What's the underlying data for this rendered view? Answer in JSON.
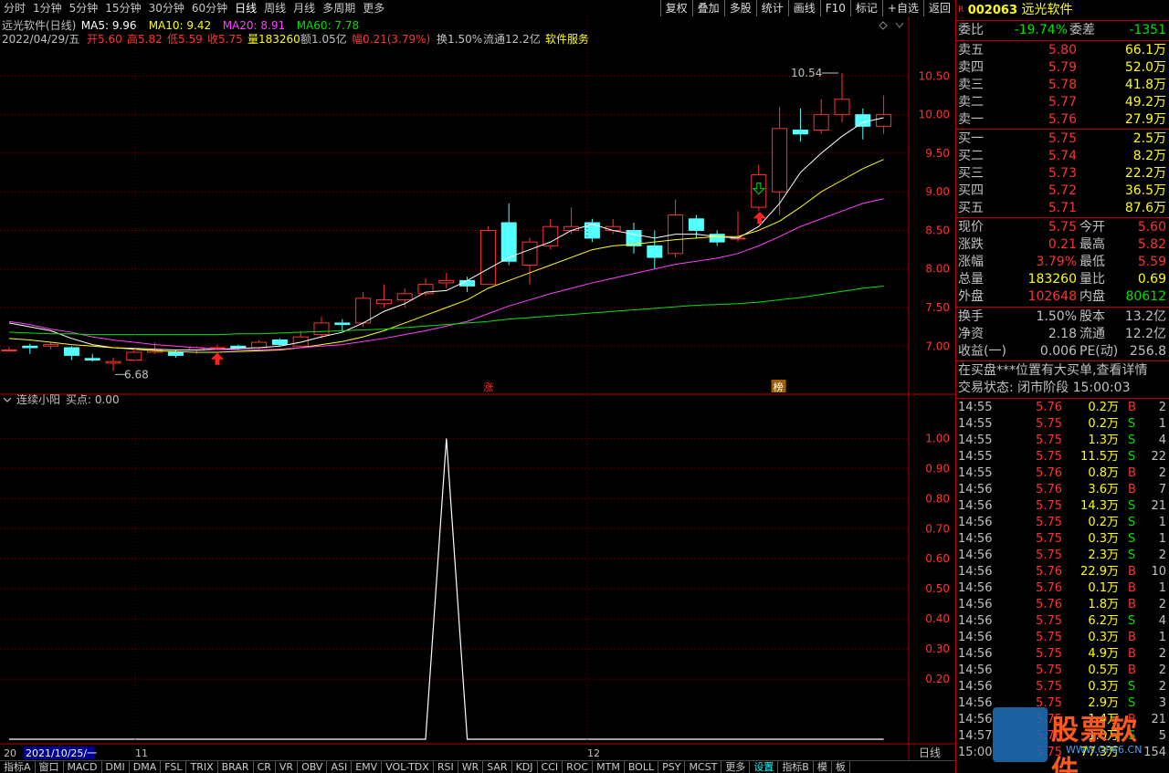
{
  "menu": {
    "items": [
      "分时",
      "1分钟",
      "5分钟",
      "15分钟",
      "30分钟",
      "60分钟",
      "日线",
      "周线",
      "月线",
      "多周期",
      "更多"
    ],
    "active": "日线",
    "right": [
      "复权",
      "叠加",
      "多股",
      "统计",
      "画线",
      "F10",
      "标记",
      "+自选",
      "返回"
    ]
  },
  "header": {
    "title": "远光软件(日线)",
    "ma5": "MA5: 9.96",
    "ma10": "MA10: 9.42",
    "ma20": "MA20: 8.91",
    "ma60": "MA60: 7.78",
    "info_date": "2022/04/29/五",
    "open": "开5.60",
    "high": "高5.82",
    "low": "低5.59",
    "close": "收5.75",
    "volume": "量183260",
    "amount": "额1.05亿",
    "change": "幅0.21(3.79%)",
    "turnover": "换1.50%",
    "float": "流通12.2亿",
    "sector": "软件服务"
  },
  "colors": {
    "up": "#ff3232",
    "down": "#54ffff",
    "ma5": "#ffffff",
    "ma10": "#ffff00",
    "ma20": "#ff40ff",
    "ma60": "#00e000"
  },
  "annotations": {
    "max_label": "10.54",
    "min_label": "6.68",
    "zhang": "涨",
    "bang": "榜"
  },
  "chart_data": [
    {
      "type": "candlestick",
      "title": "远光软件(日线)",
      "ylim": [
        6.4,
        10.8
      ],
      "y_ticks": [
        "10.50",
        "10.00",
        "9.50",
        "9.00",
        "8.50",
        "8.00",
        "7.50",
        "7.00"
      ],
      "candles": [
        [
          6.95,
          6.95,
          6.99,
          6.93
        ],
        [
          7.0,
          6.98,
          7.03,
          6.9
        ],
        [
          7.0,
          7.02,
          7.05,
          6.96
        ],
        [
          6.98,
          6.88,
          7.0,
          6.82
        ],
        [
          6.84,
          6.82,
          6.9,
          6.8
        ],
        [
          6.78,
          6.8,
          6.85,
          6.68
        ],
        [
          6.82,
          6.92,
          6.95,
          6.8
        ],
        [
          6.92,
          6.95,
          7.05,
          6.9
        ],
        [
          6.92,
          6.88,
          6.95,
          6.85
        ],
        [
          6.95,
          6.98,
          7.0,
          6.9
        ],
        [
          6.98,
          6.98,
          7.02,
          6.95
        ],
        [
          7.0,
          6.98,
          7.02,
          6.95
        ],
        [
          6.98,
          7.05,
          7.08,
          6.95
        ],
        [
          7.08,
          7.02,
          7.1,
          7.0
        ],
        [
          7.0,
          7.12,
          7.2,
          6.98
        ],
        [
          7.15,
          7.3,
          7.38,
          7.1
        ],
        [
          7.3,
          7.28,
          7.35,
          7.2
        ],
        [
          7.3,
          7.62,
          7.7,
          7.25
        ],
        [
          7.55,
          7.6,
          7.8,
          7.5
        ],
        [
          7.6,
          7.68,
          7.75,
          7.5
        ],
        [
          7.68,
          7.8,
          7.88,
          7.65
        ],
        [
          7.82,
          7.85,
          7.95,
          7.75
        ],
        [
          7.85,
          7.78,
          7.9,
          7.7
        ],
        [
          7.8,
          8.5,
          8.55,
          7.8
        ],
        [
          8.6,
          8.1,
          8.85,
          8.05
        ],
        [
          8.05,
          8.35,
          8.4,
          7.8
        ],
        [
          8.3,
          8.55,
          8.65,
          8.25
        ],
        [
          8.5,
          8.55,
          8.8,
          8.45
        ],
        [
          8.6,
          8.4,
          8.65,
          8.35
        ],
        [
          8.5,
          8.55,
          8.65,
          8.45
        ],
        [
          8.5,
          8.3,
          8.6,
          8.2
        ],
        [
          8.3,
          8.15,
          8.5,
          8.0
        ],
        [
          8.2,
          8.7,
          8.9,
          8.15
        ],
        [
          8.65,
          8.5,
          8.7,
          8.4
        ],
        [
          8.45,
          8.35,
          8.5,
          8.3
        ],
        [
          8.4,
          8.4,
          8.75,
          8.35
        ],
        [
          8.8,
          9.22,
          9.35,
          8.75
        ],
        [
          9.0,
          9.82,
          10.1,
          8.7
        ],
        [
          9.8,
          9.75,
          10.08,
          9.65
        ],
        [
          9.8,
          10.0,
          10.2,
          9.75
        ],
        [
          10.0,
          10.2,
          10.54,
          9.9
        ],
        [
          10.0,
          9.85,
          10.08,
          9.68
        ],
        [
          9.85,
          10.0,
          10.25,
          9.75
        ]
      ],
      "ma5": [
        7.3,
        7.25,
        7.2,
        7.1,
        7.02,
        6.98,
        6.97,
        6.96,
        6.95,
        6.95,
        6.96,
        6.97,
        6.98,
        7.0,
        7.05,
        7.12,
        7.18,
        7.3,
        7.45,
        7.55,
        7.7,
        7.72,
        7.85,
        8.0,
        8.15,
        8.25,
        8.35,
        8.5,
        8.58,
        8.5,
        8.45,
        8.4,
        8.45,
        8.45,
        8.42,
        8.4,
        8.55,
        8.85,
        9.25,
        9.5,
        9.72,
        9.9,
        9.96
      ],
      "ma10": [
        7.1,
        7.08,
        7.05,
        7.02,
        7.0,
        6.98,
        6.96,
        6.94,
        6.93,
        6.92,
        6.92,
        6.93,
        6.94,
        6.95,
        6.98,
        7.02,
        7.06,
        7.12,
        7.2,
        7.3,
        7.4,
        7.5,
        7.6,
        7.75,
        7.85,
        7.95,
        8.05,
        8.15,
        8.25,
        8.3,
        8.32,
        8.35,
        8.38,
        8.4,
        8.42,
        8.42,
        8.5,
        8.62,
        8.8,
        9.0,
        9.15,
        9.3,
        9.42
      ],
      "ma20": [
        7.32,
        7.28,
        7.22,
        7.18,
        7.12,
        7.08,
        7.05,
        7.02,
        7.0,
        6.98,
        6.96,
        6.95,
        6.95,
        6.96,
        6.98,
        7.0,
        7.02,
        7.06,
        7.1,
        7.15,
        7.2,
        7.26,
        7.32,
        7.42,
        7.52,
        7.6,
        7.68,
        7.75,
        7.82,
        7.88,
        7.94,
        8.0,
        8.06,
        8.1,
        8.14,
        8.2,
        8.3,
        8.42,
        8.55,
        8.65,
        8.75,
        8.85,
        8.91
      ],
      "ma60": [
        7.18,
        7.17,
        7.16,
        7.16,
        7.15,
        7.15,
        7.15,
        7.15,
        7.15,
        7.15,
        7.15,
        7.16,
        7.16,
        7.17,
        7.18,
        7.19,
        7.2,
        7.21,
        7.22,
        7.24,
        7.26,
        7.28,
        7.3,
        7.32,
        7.35,
        7.37,
        7.39,
        7.41,
        7.43,
        7.45,
        7.47,
        7.49,
        7.51,
        7.53,
        7.54,
        7.55,
        7.57,
        7.6,
        7.63,
        7.67,
        7.71,
        7.75,
        7.78
      ],
      "x_labels": [
        "20",
        "2021/10/25/一",
        "11",
        "12"
      ]
    },
    {
      "type": "line",
      "title": "连续小阳",
      "series": [
        {
          "name": "买点",
          "values": [
            0,
            0,
            0,
            0,
            0,
            0,
            0,
            0,
            0,
            0,
            0,
            0,
            0,
            0,
            0,
            0,
            0,
            0,
            0,
            0,
            0,
            1,
            0,
            0,
            0,
            0,
            0,
            0,
            0,
            0,
            0,
            0,
            0,
            0,
            0,
            0,
            0,
            0,
            0,
            0,
            0,
            0,
            0
          ]
        }
      ],
      "ylim": [
        0,
        1.08
      ],
      "y_ticks": [
        "1.00",
        "0.90",
        "0.80",
        "0.70",
        "0.60",
        "0.50",
        "0.40",
        "0.30",
        "0.20"
      ]
    }
  ],
  "indicator": {
    "title": "连续小阳",
    "label": "买点: 0.00"
  },
  "period_label": "日线",
  "tabs": [
    "指标A",
    "窗口",
    "MACD",
    "DMI",
    "DMA",
    "FSL",
    "TRIX",
    "BRAR",
    "CR",
    "VR",
    "OBV",
    "ASI",
    "EMV",
    "VOL-TDX",
    "RSI",
    "WR",
    "SAR",
    "KDJ",
    "CCI",
    "ROC",
    "MTM",
    "BOLL",
    "PSY",
    "MCST",
    "更多",
    "设置",
    "指标B",
    "模",
    "板"
  ],
  "stock": {
    "code": "002063",
    "name": "远光软件",
    "badge": "R"
  },
  "weibi": {
    "label": "委比",
    "value": "-19.74%",
    "diff_label": "委差",
    "diff": "-1351"
  },
  "asks": [
    {
      "label": "卖五",
      "price": "5.80",
      "vol": "66.1万"
    },
    {
      "label": "卖四",
      "price": "5.79",
      "vol": "52.0万"
    },
    {
      "label": "卖三",
      "price": "5.78",
      "vol": "41.8万"
    },
    {
      "label": "卖二",
      "price": "5.77",
      "vol": "49.2万"
    },
    {
      "label": "卖一",
      "price": "5.76",
      "vol": "27.9万"
    }
  ],
  "bids": [
    {
      "label": "买一",
      "price": "5.75",
      "vol": "2.5万"
    },
    {
      "label": "买二",
      "price": "5.74",
      "vol": "8.2万"
    },
    {
      "label": "买三",
      "price": "5.73",
      "vol": "22.2万"
    },
    {
      "label": "买四",
      "price": "5.72",
      "vol": "36.5万"
    },
    {
      "label": "买五",
      "price": "5.71",
      "vol": "87.6万"
    }
  ],
  "quote": [
    {
      "l1": "现价",
      "v1": "5.75",
      "l2": "今开",
      "v2": "5.60",
      "c1": "#ff3232",
      "c2": "#ff3232"
    },
    {
      "l1": "涨跌",
      "v1": "0.21",
      "l2": "最高",
      "v2": "5.82",
      "c1": "#ff3232",
      "c2": "#ff3232"
    },
    {
      "l1": "涨幅",
      "v1": "3.79%",
      "l2": "最低",
      "v2": "5.59",
      "c1": "#ff3232",
      "c2": "#ff3232"
    },
    {
      "l1": "总量",
      "v1": "183260",
      "l2": "量比",
      "v2": "0.69",
      "c1": "#ffff00",
      "c2": "#ffff00"
    },
    {
      "l1": "外盘",
      "v1": "102648",
      "l2": "内盘",
      "v2": "80612",
      "c1": "#ff3232",
      "c2": "#00e000"
    }
  ],
  "quote2": [
    {
      "l1": "换手",
      "v1": "1.50%",
      "l2": "股本",
      "v2": "13.2亿"
    },
    {
      "l1": "净资",
      "v1": "2.18",
      "l2": "流通",
      "v2": "12.2亿"
    },
    {
      "l1": "收益(一)",
      "v1": "0.006",
      "l2": "PE(动)",
      "v2": "256.8"
    }
  ],
  "notice": "在买盘***位置有大买单,查看详情",
  "status": "交易状态: 闭市阶段 15:00:03",
  "ticks": [
    [
      "14:55",
      "5.76",
      "0.2万",
      "B",
      "2"
    ],
    [
      "14:55",
      "5.75",
      "0.2万",
      "S",
      "1"
    ],
    [
      "14:55",
      "5.75",
      "1.3万",
      "S",
      "4"
    ],
    [
      "14:55",
      "5.75",
      "11.5万",
      "S",
      "22"
    ],
    [
      "14:55",
      "5.76",
      "0.8万",
      "B",
      "2"
    ],
    [
      "14:56",
      "5.76",
      "3.6万",
      "B",
      "7"
    ],
    [
      "14:56",
      "5.75",
      "14.3万",
      "S",
      "21"
    ],
    [
      "14:56",
      "5.75",
      "0.2万",
      "S",
      "1"
    ],
    [
      "14:56",
      "5.75",
      "0.3万",
      "S",
      "1"
    ],
    [
      "14:56",
      "5.75",
      "2.3万",
      "S",
      "2"
    ],
    [
      "14:56",
      "5.76",
      "22.9万",
      "B",
      "10"
    ],
    [
      "14:56",
      "5.76",
      "0.1万",
      "B",
      "1"
    ],
    [
      "14:56",
      "5.76",
      "1.8万",
      "B",
      "2"
    ],
    [
      "14:56",
      "5.75",
      "6.2万",
      "S",
      "4"
    ],
    [
      "14:56",
      "5.75",
      "0.3万",
      "B",
      "1"
    ],
    [
      "14:56",
      "5.75",
      "4.9万",
      "B",
      "2"
    ],
    [
      "14:56",
      "5.75",
      "0.5万",
      "B",
      "2"
    ],
    [
      "14:56",
      "5.75",
      "0.3万",
      "S",
      "2"
    ],
    [
      "14:56",
      "5.75",
      "2.9万",
      "S",
      "3"
    ],
    [
      "14:56",
      "5.75",
      "1.4万",
      "B",
      "21"
    ],
    [
      "14:57",
      "5.76",
      "1.0万",
      "S",
      "5"
    ],
    [
      "15:00",
      "5.75",
      "77.3万",
      "",
      "154"
    ]
  ],
  "watermark": {
    "text": "股票软件",
    "url": "WWW.GP66.CN"
  }
}
